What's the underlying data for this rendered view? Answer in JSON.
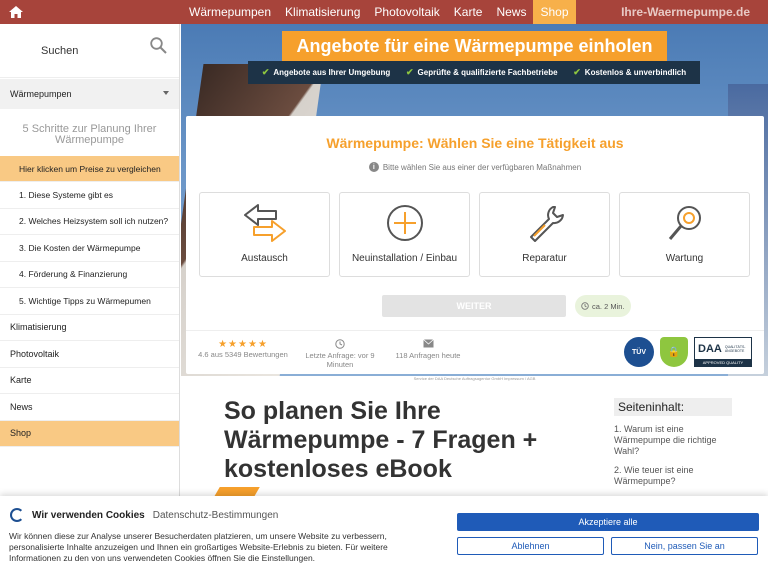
{
  "nav": {
    "items": [
      "Wärmepumpen",
      "Klimatisierung",
      "Photovoltaik",
      "Karte",
      "News",
      "Shop"
    ],
    "brand": "Ihre-Waermepumpe.de"
  },
  "sidebar": {
    "search_label": "Suchen",
    "section": "Wärmepumpen",
    "sub_title": "5 Schritte zur Planung Ihrer Wärmepumpe",
    "sub_items": [
      "Hier klicken um Preise zu vergleichen",
      "1. Diese Systeme gibt es",
      "2. Welches Heizsystem soll ich nutzen?",
      "3. Die Kosten der Wärmepumpe",
      "4. Förderung & Finanzierung",
      "5. Wichtige Tipps zu Wärmepumen"
    ],
    "main_items": [
      "Klimatisierung",
      "Photovoltaik",
      "Karte",
      "News",
      "Shop"
    ]
  },
  "hero": {
    "title": "Angebote für eine Wärmepumpe einholen",
    "bullets": [
      "Angebote aus Ihrer Umgebung",
      "Geprüfte & qualifizierte Fachbetriebe",
      "Kostenlos & unverbindlich"
    ]
  },
  "card": {
    "title": "Wärmepumpe: Wählen Sie eine Tätigkeit aus",
    "hint": "Bitte wählen Sie aus einer der verfügbaren Maßnahmen",
    "options": [
      "Austausch",
      "Neuinstallation / Einbau",
      "Reparatur",
      "Wartung"
    ],
    "weiter": "WEITER",
    "duration": "ca. 2 Min.",
    "rating": "4.6 aus 5349 Bewertungen",
    "last_request": "Letzte Anfrage: vor 9 Minuten",
    "requests_today": "118 Anfragen heute",
    "badges": {
      "tuv": "TÜV",
      "daa": "DAA",
      "daa_small": "QUALITÄTS-ANGEBOTE",
      "daa_bottom": "APPROVED QUALITY"
    }
  },
  "service_line": "Service der DAA Deutsche Auftragsagentur GmbH  Impressum / AGB",
  "article": {
    "title": "So planen Sie Ihre Wärmepumpe - 7 Fragen + kostenloses eBook"
  },
  "toc": {
    "title": "Seiteninhalt:",
    "items": [
      "1. Warum ist eine Wärmepumpe die richtige Wahl?",
      "2. Wie teuer ist eine Wärmepumpe?"
    ]
  },
  "cookie": {
    "title": "Wir verwenden Cookies",
    "link": "Datenschutz-Bestimmungen",
    "text": "Wir können diese zur Analyse unserer Besucherdaten platzieren, um unsere Website zu verbessern, personalisierte Inhalte anzuzeigen und Ihnen ein großartiges Website-Erlebnis zu bieten. Für weitere Informationen zu den von uns verwendeten Cookies öffnen Sie die Einstellungen.",
    "accept": "Akzeptiere alle",
    "reject": "Ablehnen",
    "settings": "Nein, passen Sie an"
  }
}
